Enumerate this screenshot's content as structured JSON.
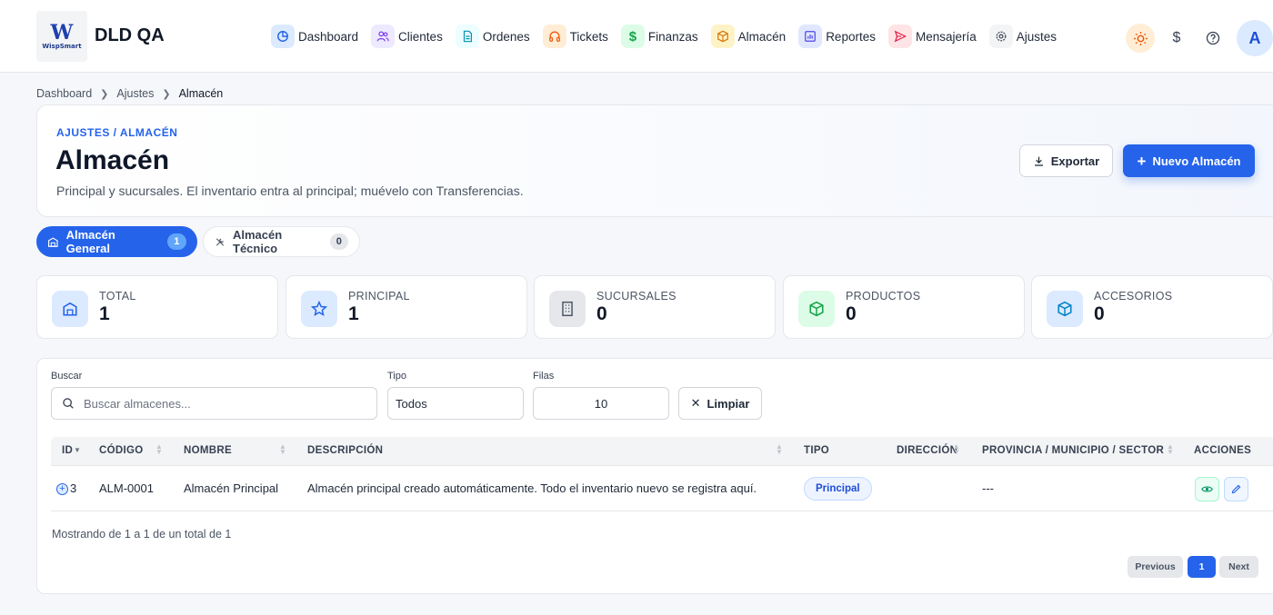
{
  "app": {
    "logo_mark": "W",
    "logo_text": "WispSmart",
    "title": "DLD QA"
  },
  "nav": [
    {
      "label": "Dashboard",
      "icon": "dashboard-icon",
      "color": "#dbeafe",
      "fg": "#2563eb"
    },
    {
      "label": "Clientes",
      "icon": "users-icon",
      "color": "#ede9fe",
      "fg": "#7c3aed"
    },
    {
      "label": "Ordenes",
      "icon": "document-icon",
      "color": "#ecfeff",
      "fg": "#0891b2"
    },
    {
      "label": "Tickets",
      "icon": "headphones-icon",
      "color": "#ffedd5",
      "fg": "#ea580c"
    },
    {
      "label": "Finanzas",
      "icon": "dollar-icon",
      "color": "#dcfce7",
      "fg": "#16a34a"
    },
    {
      "label": "Almacén",
      "icon": "box-icon",
      "color": "#fef3c7",
      "fg": "#d97706"
    },
    {
      "label": "Reportes",
      "icon": "chart-icon",
      "color": "#e0e7ff",
      "fg": "#4f46e5"
    },
    {
      "label": "Mensajería",
      "icon": "send-icon",
      "color": "#ffe4e6",
      "fg": "#e11d48"
    },
    {
      "label": "Ajustes",
      "icon": "gear-icon",
      "color": "#f3f4f6",
      "fg": "#374151"
    }
  ],
  "user": {
    "avatar_initial": "A"
  },
  "breadcrumb": [
    "Dashboard",
    "Ajustes",
    "Almacén"
  ],
  "header": {
    "eyebrow": "AJUSTES / ALMACÉN",
    "title": "Almacén",
    "subtitle": "Principal y sucursales. El inventario entra al principal; muévelo con Transferencias.",
    "export_label": "Exportar",
    "new_label": "Nuevo Almacén"
  },
  "tabs": [
    {
      "label": "Almacén General",
      "count": "1",
      "active": true
    },
    {
      "label": "Almacén Técnico",
      "count": "0",
      "active": false
    }
  ],
  "stats": [
    {
      "label": "TOTAL",
      "value": "1",
      "icon": "warehouse-icon",
      "bg": "#dbeafe",
      "fg": "#2563eb"
    },
    {
      "label": "PRINCIPAL",
      "value": "1",
      "icon": "star-icon",
      "bg": "#dbeafe",
      "fg": "#2563eb"
    },
    {
      "label": "SUCURSALES",
      "value": "0",
      "icon": "building-icon",
      "bg": "#e5e7eb",
      "fg": "#4b5563"
    },
    {
      "label": "PRODUCTOS",
      "value": "0",
      "icon": "package-icon",
      "bg": "#dcfce7",
      "fg": "#16a34a"
    },
    {
      "label": "ACCESORIOS",
      "value": "0",
      "icon": "cube-icon",
      "bg": "#dbeafe",
      "fg": "#0284c7"
    }
  ],
  "filters": {
    "search_label": "Buscar",
    "search_placeholder": "Buscar almacenes...",
    "tipo_label": "Tipo",
    "tipo_value": "Todos",
    "filas_label": "Filas",
    "filas_value": "10",
    "clear_label": "Limpiar"
  },
  "table": {
    "columns": [
      "ID",
      "CÓDIGO",
      "NOMBRE",
      "DESCRIPCIÓN",
      "TIPO",
      "DIRECCIÓN",
      "PROVINCIA / MUNICIPIO / SECTOR",
      "ACCIONES"
    ],
    "rows": [
      {
        "id": "3",
        "codigo": "ALM-0001",
        "nombre": "Almacén Principal",
        "descripcion": "Almacén principal creado automáticamente. Todo el inventario nuevo se registra aquí.",
        "tipo": "Principal",
        "direccion": "",
        "provincia": "---"
      }
    ],
    "showing": "Mostrando de 1 a 1 de un total de 1"
  },
  "pagination": {
    "prev": "Previous",
    "page": "1",
    "next": "Next"
  }
}
